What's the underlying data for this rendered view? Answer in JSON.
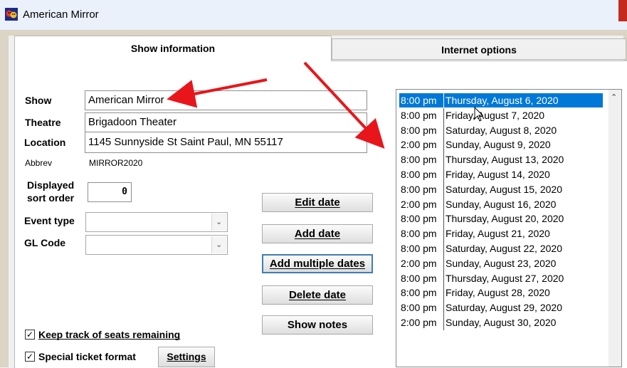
{
  "window": {
    "title": "American Mirror"
  },
  "tabs": [
    {
      "label": "Show information"
    },
    {
      "label": "Internet options"
    }
  ],
  "form": {
    "show_label": "Show",
    "show_value": "American Mirror",
    "theatre_label": "Theatre",
    "theatre_value": "Brigadoon Theater",
    "location_label": "Location",
    "location_value": "1145 Sunnyside St Saint Paul, MN 55117",
    "abbrev_label": "Abbrev",
    "abbrev_value": "MIRROR2020",
    "sort_label_line1": "Displayed",
    "sort_label_line2": "sort order",
    "sort_value": "0",
    "event_type_label": "Event type",
    "event_type_value": "",
    "gl_code_label": "GL Code",
    "gl_code_value": ""
  },
  "buttons": {
    "edit_date": "Edit date",
    "add_date": "Add date",
    "add_multiple_dates": "Add multiple dates",
    "delete_date": "Delete date",
    "show_notes": "Show notes",
    "settings": "Settings"
  },
  "checkboxes": {
    "keep_track": {
      "label": "Keep track of seats remaining",
      "checked": true
    },
    "special_ticket": {
      "label": "Special ticket format",
      "checked": true
    }
  },
  "dates": [
    {
      "time": "8:00 pm",
      "date": "Thursday, August 6, 2020",
      "selected": true
    },
    {
      "time": "8:00 pm",
      "date": "Friday, August 7, 2020"
    },
    {
      "time": "8:00 pm",
      "date": "Saturday, August 8, 2020"
    },
    {
      "time": "2:00 pm",
      "date": "Sunday, August 9, 2020"
    },
    {
      "time": "8:00 pm",
      "date": "Thursday, August 13, 2020"
    },
    {
      "time": "8:00 pm",
      "date": "Friday, August 14, 2020"
    },
    {
      "time": "8:00 pm",
      "date": "Saturday, August 15, 2020"
    },
    {
      "time": "2:00 pm",
      "date": "Sunday, August 16, 2020"
    },
    {
      "time": "8:00 pm",
      "date": "Thursday, August 20, 2020"
    },
    {
      "time": "8:00 pm",
      "date": "Friday, August 21, 2020"
    },
    {
      "time": "8:00 pm",
      "date": "Saturday, August 22, 2020"
    },
    {
      "time": "2:00 pm",
      "date": "Sunday, August 23, 2020"
    },
    {
      "time": "8:00 pm",
      "date": "Thursday, August 27, 2020"
    },
    {
      "time": "8:00 pm",
      "date": "Friday, August 28, 2020"
    },
    {
      "time": "8:00 pm",
      "date": "Saturday, August 29, 2020"
    },
    {
      "time": "2:00 pm",
      "date": "Sunday, August 30, 2020"
    }
  ],
  "icons": {
    "app": "theater-masks-icon",
    "combo_arrow": "chevron-down-icon",
    "scroll_up": "chevron-up-icon",
    "checkmark": "check-icon"
  },
  "colors": {
    "selection": "#0078d7",
    "annotation_arrow": "#e8161b",
    "focus_border": "#3c7fb1"
  }
}
